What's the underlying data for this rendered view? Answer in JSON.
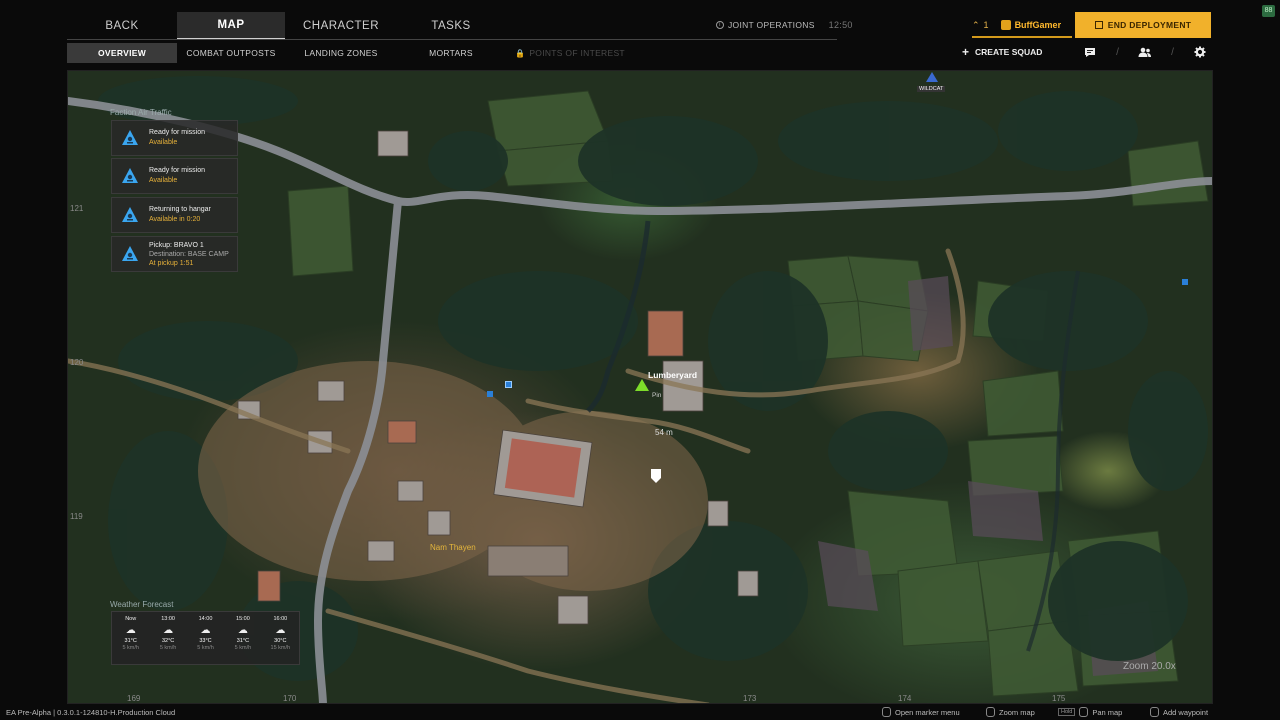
{
  "topnav": {
    "tabs": [
      {
        "label": "BACK",
        "active": false
      },
      {
        "label": "MAP",
        "active": true
      },
      {
        "label": "CHARACTER",
        "active": false
      },
      {
        "label": "TASKS",
        "active": false
      }
    ]
  },
  "subnav": {
    "tabs": [
      {
        "label": "OVERVIEW",
        "active": true
      },
      {
        "label": "COMBAT OUTPOSTS",
        "active": false
      },
      {
        "label": "LANDING ZONES",
        "active": false
      },
      {
        "label": "MORTARS",
        "active": false
      },
      {
        "label": "POINTS OF INTEREST",
        "active": false,
        "disabled": true
      }
    ]
  },
  "header": {
    "mode": "JOINT OPERATIONS",
    "time": "12:50",
    "player_count": "1",
    "player_name": "BuffGamer",
    "end_button": "END DEPLOYMENT",
    "create_squad": "CREATE SQUAD",
    "corner_badge": "88"
  },
  "air_traffic": {
    "title": "Faction Air Traffic",
    "cards": [
      {
        "line1": "Ready for mission",
        "line2": "Available"
      },
      {
        "line1": "Ready for mission",
        "line2": "Available"
      },
      {
        "line1": "Returning to hangar",
        "line2": "Available in 0:20"
      },
      {
        "line1": "Pickup: BRAVO 1",
        "line2": "Destination: BASE CAMP",
        "line3": "At pickup 1:51"
      }
    ]
  },
  "weather": {
    "title": "Weather Forecast",
    "columns": [
      {
        "hour": "Now",
        "icon": "cloud-rain-icon",
        "temp": "31°C",
        "wind": "5 km/h"
      },
      {
        "hour": "13:00",
        "icon": "cloud-rain-icon",
        "temp": "32°C",
        "wind": "5 km/h"
      },
      {
        "hour": "14:00",
        "icon": "cloud-rain-icon",
        "temp": "33°C",
        "wind": "5 km/h"
      },
      {
        "hour": "15:00",
        "icon": "cloud-rain-icon",
        "temp": "31°C",
        "wind": "5 km/h"
      },
      {
        "hour": "16:00",
        "icon": "cloud-rain-icon",
        "temp": "30°C",
        "wind": "15 km/h"
      }
    ]
  },
  "map": {
    "labels": {
      "lumberyard": "Lumberyard",
      "lumberyard_sub": "Pin",
      "distance": "54 m",
      "village": "Nam Thayen",
      "wildcat": "WILDCAT"
    },
    "grid": {
      "y121": "121",
      "y120": "120",
      "y119": "119",
      "x169": "169",
      "x170": "170",
      "x173": "173",
      "x174": "174",
      "x175": "175"
    },
    "zoom": "Zoom 20.0x"
  },
  "footer": {
    "version": "EA Pre-Alpha | 0.3.0.1-124810-H.Production Cloud",
    "hints": [
      {
        "label": "Open marker menu"
      },
      {
        "label": "Zoom map"
      },
      {
        "label": "Pan map",
        "hold": "Hold"
      },
      {
        "label": "Add waypoint"
      }
    ]
  },
  "colors": {
    "accent": "#f1b12b",
    "player_marker": "#7ddc2a",
    "air_icon": "#3aa6f0"
  }
}
